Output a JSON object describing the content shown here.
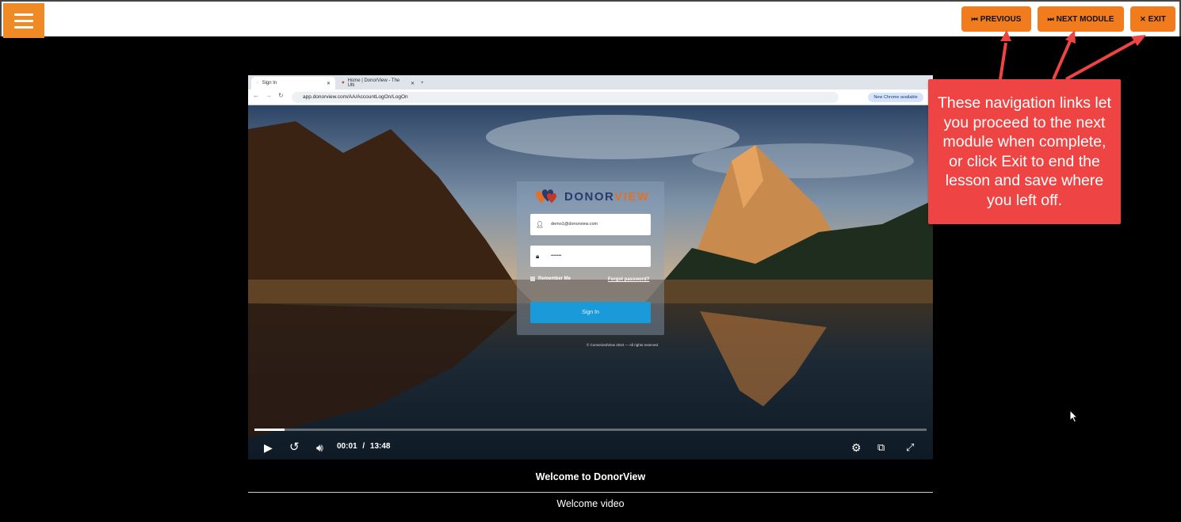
{
  "header": {
    "menu_icon": "hamburger-icon",
    "previous_label": "PREVIOUS",
    "next_label": "NEXT MODULE",
    "exit_label": "EXIT",
    "accent_color": "#f07c1e"
  },
  "callout": {
    "text": "These navigation links let you proceed to the next module when complete, or click Exit to end the lesson and save where you left off.",
    "color": "#ee4444"
  },
  "browser": {
    "tab1": "Sign In",
    "tab2": "Home | DonorView - The Ulti",
    "url": "app.donorview.com/AA/AccountLogOn/LogOn",
    "new_chrome": "New Chrome available"
  },
  "login": {
    "brand_a": "DONOR",
    "brand_b": "VIEW",
    "email": "demo1@donorview.com",
    "password": "•••••••",
    "remember": "Remember Me",
    "forgot": "Forgot password?",
    "signin": "Sign In",
    "copyright": "© ConnectedView 2024 — All rights reserved"
  },
  "player": {
    "current_time": "00:01",
    "separator": "/",
    "duration": "13:48",
    "progress": 0.045
  },
  "lesson": {
    "title": "Welcome to DonorView",
    "subtitle": "Welcome video"
  }
}
